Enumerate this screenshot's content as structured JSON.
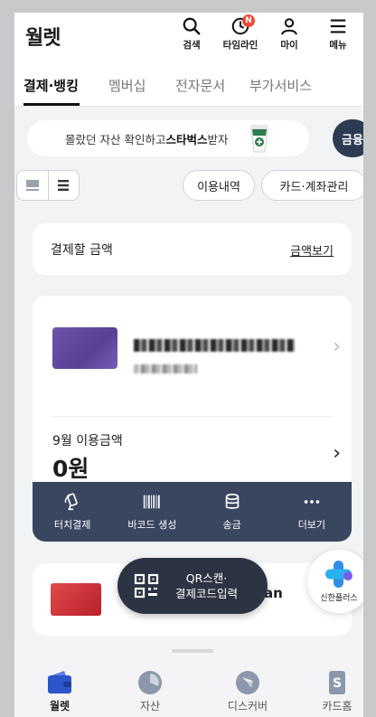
{
  "header": {
    "title": "월렛",
    "icons": [
      {
        "label": "검색",
        "icon": "search-icon"
      },
      {
        "label": "타임라인",
        "icon": "clock-icon",
        "badge": "N"
      },
      {
        "label": "마이",
        "icon": "user-icon"
      },
      {
        "label": "메뉴",
        "icon": "menu-icon"
      }
    ]
  },
  "tabs": [
    "결제·뱅킹",
    "멤버십",
    "전자문서",
    "부가서비스"
  ],
  "banner": {
    "text_prefix": "몰랐던 자산 확인하고 ",
    "text_bold": "스타벅스",
    "text_suffix": " 받자"
  },
  "finance_button": "금융",
  "filters": {
    "usage_history": "이용내역",
    "card_account_manage": "카드·계좌관리"
  },
  "pay_amount": {
    "label": "결제할 금액",
    "link": "금액보기"
  },
  "card": {
    "month_label": "9월 이용금액",
    "amount": "0원"
  },
  "actions": [
    {
      "label": "터치결제",
      "icon": "touch-pay-icon"
    },
    {
      "label": "바코드 생성",
      "icon": "barcode-icon"
    },
    {
      "label": "송금",
      "icon": "coins-icon"
    },
    {
      "label": "더보기",
      "icon": "more-icon"
    }
  ],
  "second_card": {
    "partial_text": "an"
  },
  "qr": {
    "line1": "QR스캔·",
    "line2": "결제코드입력"
  },
  "plus": {
    "label": "신한플러스"
  },
  "bottom_nav": [
    {
      "label": "월렛",
      "active": true,
      "icon": "wallet-icon"
    },
    {
      "label": "자산",
      "active": false,
      "icon": "pie-chart-icon"
    },
    {
      "label": "디스커버",
      "active": false,
      "icon": "compass-icon"
    },
    {
      "label": "카드홈",
      "active": false,
      "icon": "card-home-icon"
    }
  ],
  "colors": {
    "accent": "#2d3a52",
    "action_bar": "#3a4660",
    "badge": "#f04a3a",
    "wallet_blue": "#2b55c8"
  }
}
